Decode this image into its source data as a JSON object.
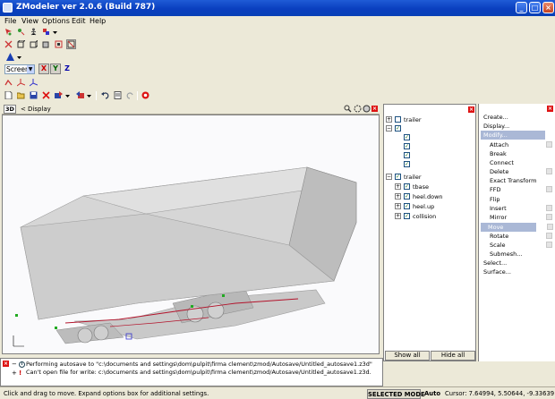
{
  "window": {
    "title": "ZModeler ver 2.0.6 (Build 787)",
    "minimize": "_",
    "maximize": "□",
    "close": "×"
  },
  "menu": {
    "items": [
      "File",
      "View",
      "Options",
      "Edit",
      "Help"
    ]
  },
  "toolbar": {
    "screen_select_value": "Screen",
    "axis_x": "X",
    "axis_y": "Y",
    "axis_z": "Z"
  },
  "viewport": {
    "mode_label": "3D",
    "back_glyph": "<",
    "display_label": "Display"
  },
  "tree": {
    "items": [
      {
        "label": "trailer"
      },
      {
        "label": ""
      },
      {
        "label": ""
      },
      {
        "label": ""
      },
      {
        "label": ""
      },
      {
        "label": ""
      },
      {
        "label": "trailer"
      },
      {
        "label": "tbase"
      },
      {
        "label": "heel.down"
      },
      {
        "label": "heel.up"
      },
      {
        "label": "collision"
      }
    ],
    "show_all": "Show all",
    "hide_all": "Hide all"
  },
  "commands": {
    "items": [
      {
        "label": "Create..."
      },
      {
        "label": "Display..."
      },
      {
        "label": "Modify..."
      },
      {
        "label": "Attach"
      },
      {
        "label": "Break"
      },
      {
        "label": "Connect"
      },
      {
        "label": "Delete"
      },
      {
        "label": "Exact Transform"
      },
      {
        "label": "FFD"
      },
      {
        "label": "Flip"
      },
      {
        "label": "Insert"
      },
      {
        "label": "Mirror"
      },
      {
        "label": "Move"
      },
      {
        "label": "Rotate"
      },
      {
        "label": "Scale"
      },
      {
        "label": "Submesh..."
      },
      {
        "label": "Select..."
      },
      {
        "label": "Surface..."
      }
    ]
  },
  "log": {
    "lines": [
      {
        "text": "Performing autosave to \"c:\\documents and settings\\dom\\pulpit\\firma clement\\zmod/Autosave/Untitled_autosave1.z3d\""
      },
      {
        "text": "Can't open file for write: c:\\documents and settings\\dom\\pulpit\\firma clement\\zmod/Autosave/Untitled_autosave1.z3d."
      }
    ]
  },
  "status": {
    "hint": "Click and drag to move. Expand options box for additional settings.",
    "mode": "SELECTED MODE",
    "auto": "Auto",
    "cursor": "Cursor: 7.64994, 5.50644, -9.33639"
  },
  "colors": {
    "title_blue": "#0a3fbf",
    "selection": "#aab8d6",
    "close_red": "#d11111"
  }
}
